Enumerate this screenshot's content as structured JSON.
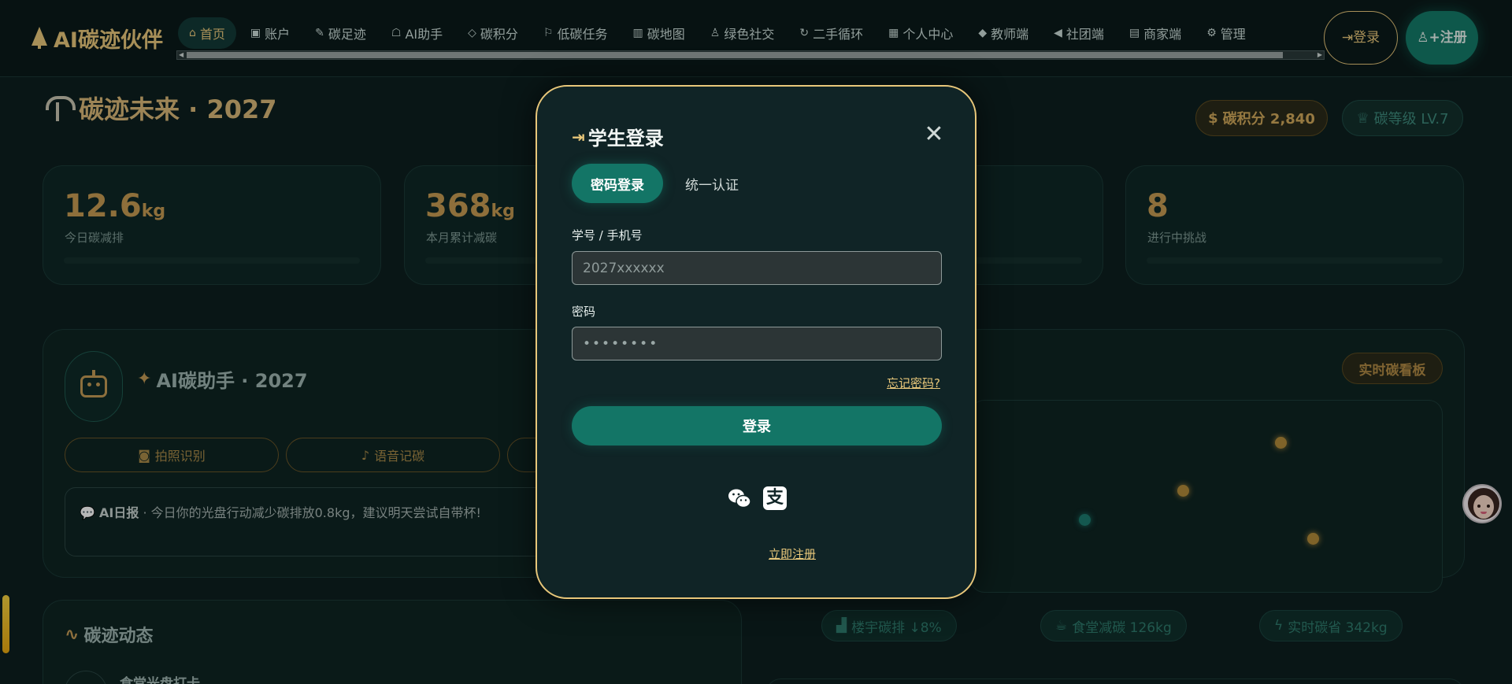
{
  "app": {
    "title": "AI碳迹伙伴"
  },
  "nav": {
    "items": [
      {
        "icon": "home-icon",
        "glyph": "⌂",
        "label": "首页",
        "active": true
      },
      {
        "icon": "account-icon",
        "glyph": "▣",
        "label": "账户"
      },
      {
        "icon": "edit-icon",
        "glyph": "✎",
        "label": "碳足迹"
      },
      {
        "icon": "robot-icon",
        "glyph": "☖",
        "label": "AI助手"
      },
      {
        "icon": "diamond-icon",
        "glyph": "◇",
        "label": "碳积分"
      },
      {
        "icon": "flag-icon",
        "glyph": "⚐",
        "label": "低碳任务"
      },
      {
        "icon": "map-icon",
        "glyph": "▥",
        "label": "碳地图"
      },
      {
        "icon": "users-icon",
        "glyph": "♙",
        "label": "绿色社交"
      },
      {
        "icon": "recycle-icon",
        "glyph": "↻",
        "label": "二手循环"
      },
      {
        "icon": "grid-icon",
        "glyph": "▦",
        "label": "个人中心"
      },
      {
        "icon": "graduation-cap-icon",
        "glyph": "◆",
        "label": "教师端"
      },
      {
        "icon": "megaphone-icon",
        "glyph": "◀",
        "label": "社团端"
      },
      {
        "icon": "store-icon",
        "glyph": "▤",
        "label": "商家端"
      },
      {
        "icon": "gear-icon",
        "glyph": "⚙",
        "label": "管理"
      }
    ],
    "login_label": "登录",
    "register_label": "注册",
    "login_glyph": "⇥",
    "register_glyph": "♙+"
  },
  "page": {
    "title": "碳迹未来 · 2027",
    "points": "碳积分 2,840",
    "level": "碳等级 LV.7",
    "stats": [
      {
        "value": "12.6",
        "unit": "kg",
        "label": "今日碳减排"
      },
      {
        "value": "368",
        "unit": "kg",
        "label": "本月累计减碳"
      },
      {
        "value": "",
        "unit": "",
        "label": ""
      },
      {
        "value": "8",
        "unit": "",
        "label": "进行中挑战"
      }
    ],
    "ai": {
      "title": "AI碳助手 · 2027",
      "buttons": [
        "拍照识别",
        "语音记碳"
      ],
      "report_bold": "AI日报",
      "report_text": " · 今日你的光盘行动减少碳排放0.8kg，建议明天尝试自带杯!"
    },
    "board": {
      "label": "实时碳看板",
      "pills": [
        "楼宇碳排 ↓8%",
        "食堂减碳 126kg",
        "实时碳省 342kg"
      ]
    },
    "feed": {
      "title": "碳迹动态",
      "first_item": "食堂光盘打卡"
    }
  },
  "modal": {
    "title": "学生登录",
    "tabs": [
      "密码登录",
      "统一认证"
    ],
    "id_label": "学号 / 手机号",
    "id_placeholder": "2027xxxxxx",
    "password_label": "密码",
    "password_value": "••••••••",
    "forgot": "忘记密码?",
    "submit": "登录",
    "register_link": "立即注册",
    "close_glyph": "✕"
  },
  "colors": {
    "accent_gold": "#e8c77a",
    "accent_teal": "#137566",
    "background": "#0d1f1f"
  }
}
